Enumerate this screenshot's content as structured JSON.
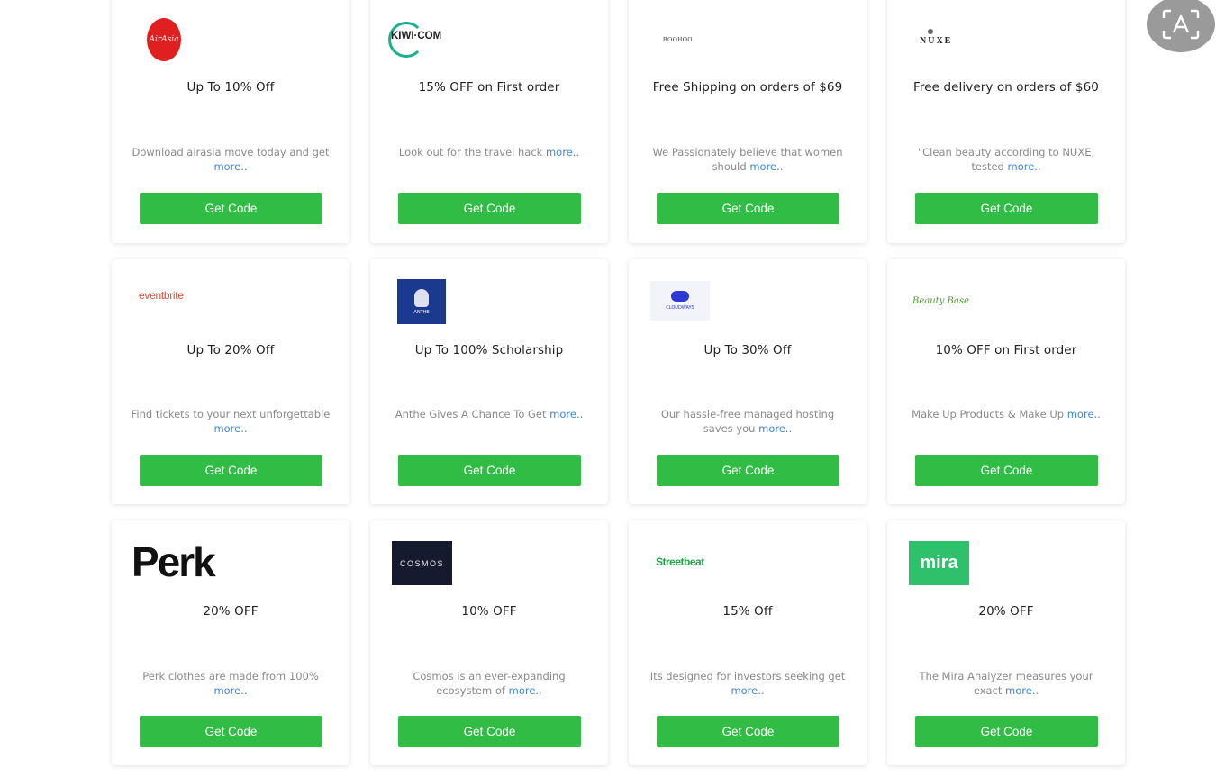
{
  "cards": [
    {
      "logo": "AirAsia",
      "title": "Up To 10% Off",
      "desc": "Download airasia move today and get",
      "more": "more..",
      "button": "Get Code"
    },
    {
      "logo": "KIWI·COM",
      "title": "15% OFF on First order",
      "desc": "Look out for the travel hack",
      "more": "more..",
      "button": "Get Code"
    },
    {
      "logo": "BOOHOO",
      "title": "Free Shipping on orders of $69",
      "desc": "We Passionately believe that women should",
      "more": "more..",
      "button": "Get Code"
    },
    {
      "logo": "NUXE",
      "title": "Free delivery on orders of $60",
      "desc": "\"Clean beauty according to NUXE, tested",
      "more": "more..",
      "button": "Get Code"
    },
    {
      "logo": "eventbrite",
      "title": "Up To 20% Off",
      "desc": "Find tickets to your next unforgettable",
      "more": "more..",
      "button": "Get Code"
    },
    {
      "logo": "ANTHE",
      "title": "Up To 100% Scholarship",
      "desc": "Anthe Gives A Chance To Get",
      "more": "more..",
      "button": "Get Code"
    },
    {
      "logo": "CLOUDWAYS",
      "title": "Up To 30% Off",
      "desc": "Our hassle-free managed hosting saves you",
      "more": "more..",
      "button": "Get Code"
    },
    {
      "logo": "Beauty Base",
      "title": "10% OFF on First order",
      "desc": "Make Up Products & Make Up",
      "more": "more..",
      "button": "Get Code"
    },
    {
      "logo": "Perk",
      "title": "20% OFF",
      "desc": "Perk clothes are made from 100%",
      "more": "more..",
      "button": "Get Code"
    },
    {
      "logo": "COSMOS",
      "title": "10% OFF",
      "desc": "Cosmos is an ever-expanding ecosystem of",
      "more": "more..",
      "button": "Get Code"
    },
    {
      "logo": "Streetbeat",
      "title": "15% Off",
      "desc": "Its designed for investors seeking get",
      "more": "more..",
      "button": "Get Code"
    },
    {
      "logo": "mira",
      "title": "20% OFF",
      "desc": "The Mira Analyzer measures your exact",
      "more": "more..",
      "button": "Get Code"
    }
  ],
  "colors": {
    "button": "#31bc45",
    "more_link": "#3d88d6"
  },
  "overlay_icon": "text-recognition-icon"
}
